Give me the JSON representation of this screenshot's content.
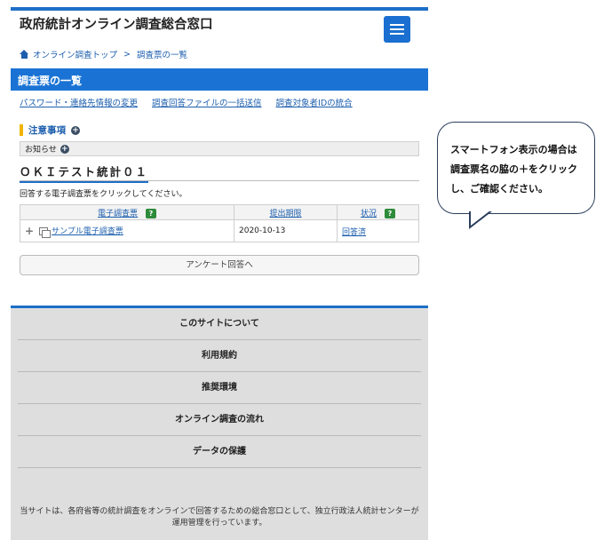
{
  "header": {
    "site_title": "政府統計オンライン調査総合窓口",
    "menu_icon": "hamburger-icon"
  },
  "breadcrumb": {
    "home": "オンライン調査トップ",
    "separator": ">",
    "current": "調査票の一覧"
  },
  "page_title": "調査票の一覧",
  "subnav": [
    "パスワード・連絡先情報の変更",
    "調査回答ファイルの一括送信",
    "調査対象者IDの統合"
  ],
  "notice": {
    "heading": "注意事項",
    "oshirase": "お知らせ"
  },
  "survey": {
    "title": "ＯＫＩテスト統計０１",
    "instruction": "回答する電子調査票をクリックしてください。",
    "columns": {
      "form": "電子調査票",
      "deadline": "提出期限",
      "status": "状況",
      "help_badge": "?"
    },
    "rows": [
      {
        "name": "サンプル電子調査票",
        "deadline": "2020-10-13",
        "status": "回答済"
      }
    ],
    "questionnaire_button": "アンケート回答へ"
  },
  "footer": {
    "links": [
      "このサイトについて",
      "利用規約",
      "推奨環境",
      "オンライン調査の流れ",
      "データの保護"
    ],
    "description": "当サイトは、各府省等の統計調査をオンラインで回答するための総合窓口として、独立行政法人統計センターが運用管理を行っています。"
  },
  "callout": {
    "text": "スマートフォン表示の場合は調査票名の脇の＋をクリックし、ご確認ください。"
  },
  "colors": {
    "primary": "#1a73d4",
    "accent_yellow": "#f0b400",
    "badge_green": "#2e8b3a",
    "link": "#1d5fae"
  }
}
